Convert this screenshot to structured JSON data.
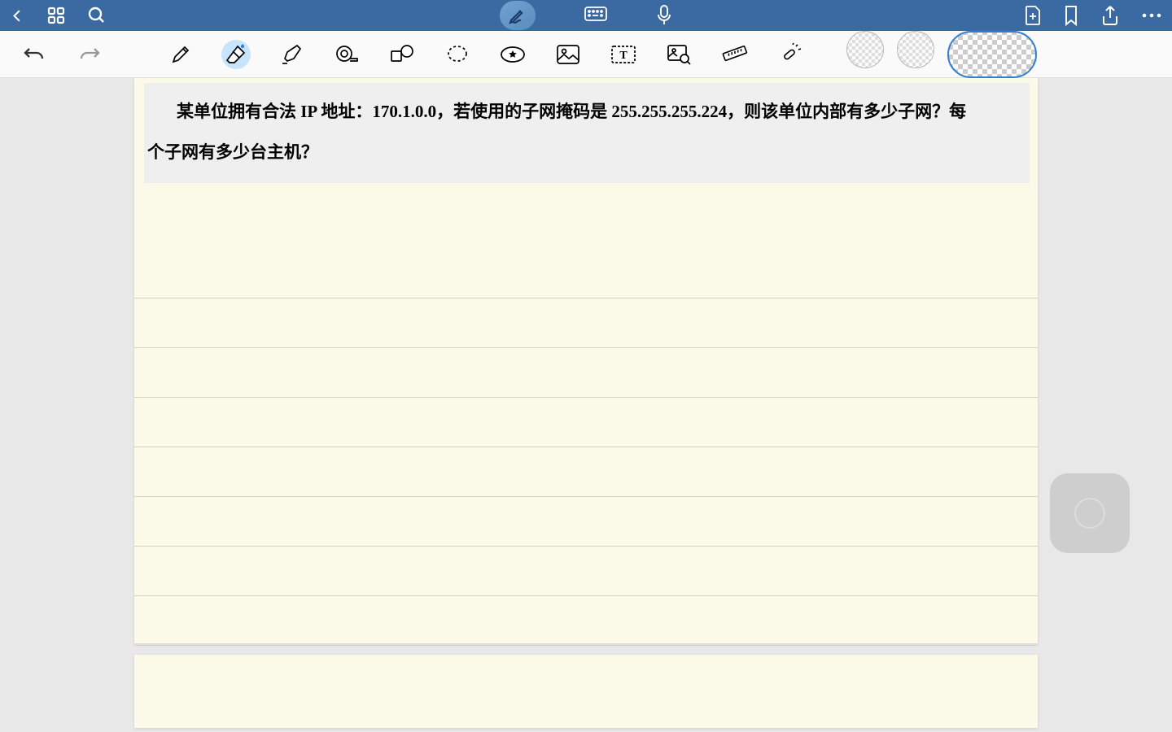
{
  "question": {
    "text_part1": "某单位拥有合法 IP 地址：170.1.0.0，若使用的子网掩码是  255.255.255.224，则该单位内部有多少子网？每",
    "text_part2": "个子网有多少台主机？"
  },
  "tools": {
    "undo": "undo",
    "redo": "redo",
    "pen": "pen",
    "eraser": "eraser",
    "highlighter": "highlighter",
    "tape": "tape",
    "shape": "shape",
    "lasso": "lasso",
    "favorite": "favorite",
    "image": "image",
    "text": "text",
    "zoom": "link-image",
    "ruler": "ruler",
    "laser": "laser"
  },
  "titlebar": {
    "back": "back",
    "grid": "thumbnails",
    "search": "search",
    "stylus": "stylus",
    "keyboard": "keyboard",
    "mic": "microphone",
    "addpage": "add-page",
    "bookmark": "bookmark",
    "share": "share",
    "more": "more"
  }
}
